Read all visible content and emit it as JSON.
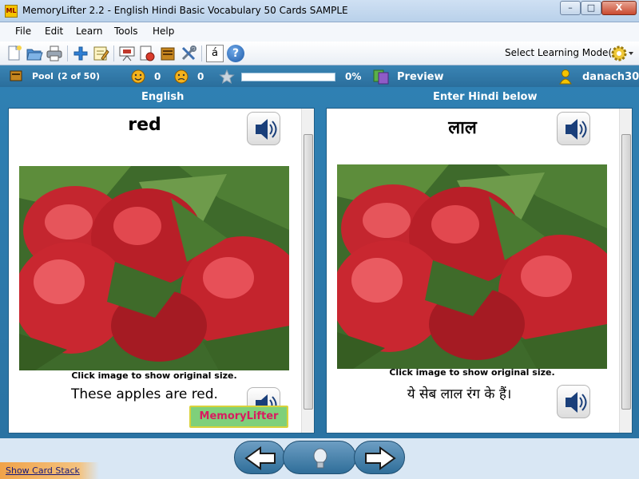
{
  "window": {
    "app_icon": "ML",
    "title": "MemoryLifter 2.2 - English Hindi Basic Vocabulary 50 Cards SAMPLE",
    "minimize": "–",
    "maximize": "□",
    "close": "X"
  },
  "menu": [
    "File",
    "Edit",
    "Learn",
    "Tools",
    "Help"
  ],
  "toolbar": {
    "icons": [
      "new-document-icon",
      "open-folder-icon",
      "print-icon",
      "add-icon",
      "edit-card-icon",
      "slideshow-icon",
      "statistics-icon",
      "card-box-icon",
      "settings-tools-icon",
      "special-character-icon",
      "help-icon"
    ],
    "special_char": "á",
    "help_char": "?",
    "mode_label": "Select Learning Mode(s)",
    "mode_icon": "gear-icon"
  },
  "status": {
    "pool_label": "Pool",
    "pool_count": "(2 of 50)",
    "correct_count": "0",
    "wrong_count": "0",
    "progress_percent": "0%",
    "progress_fraction": 0.0,
    "preview_label": "Preview",
    "username": "danach30"
  },
  "columns": {
    "left_header": "English",
    "right_header": "Enter Hindi below"
  },
  "card_left": {
    "word": "red",
    "image_hint": "Click image to show original size.",
    "sentence": "These apples are red.",
    "logo": "MemoryLifter"
  },
  "card_right": {
    "word": "लाल",
    "image_hint": "Click image to show original size.",
    "sentence": "ये सेब लाल रंग के हैं।"
  },
  "footer": {
    "show_card_stack": "Show Card Stack"
  },
  "colors": {
    "main_blue": "#2f80b3",
    "status_blue": "#2a6e9c",
    "apple_red": "#c8202a",
    "leaf_green": "#3f6b2a"
  }
}
